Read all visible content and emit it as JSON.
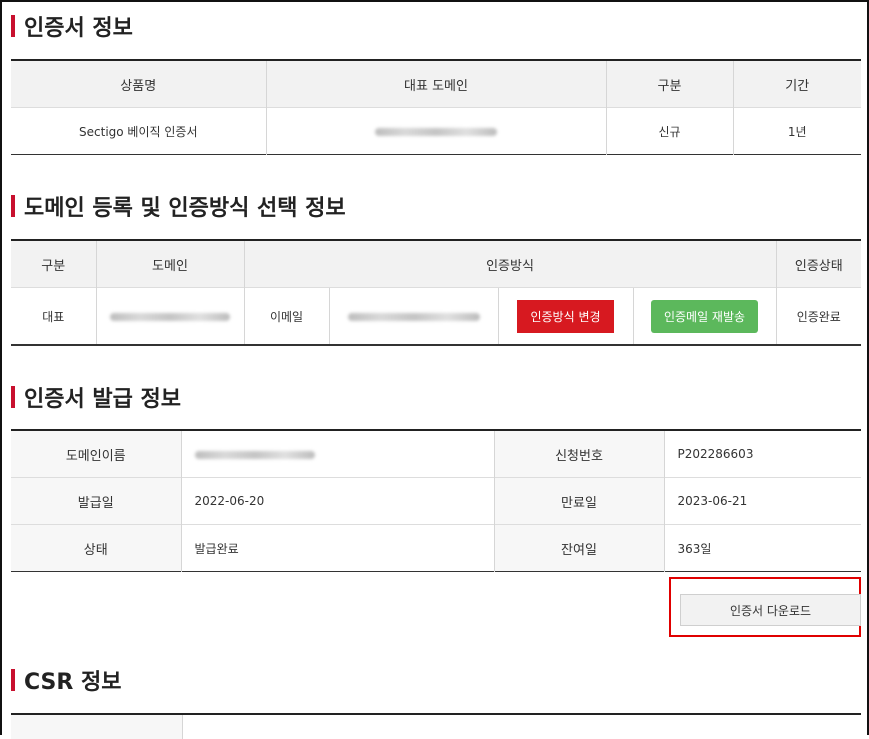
{
  "cert_info": {
    "title": "인증서 정보",
    "headers": [
      "상품명",
      "대표 도메인",
      "구분",
      "기간"
    ],
    "row": {
      "product": "Sectigo 베이직 인증서",
      "type": "신규",
      "period": "1년"
    }
  },
  "domain_info": {
    "title": "도메인 등록 및 인증방식 선택 정보",
    "headers": {
      "type": "구분",
      "domain": "도메인",
      "method": "인증방식",
      "status": "인증상태"
    },
    "row": {
      "type": "대표",
      "method": "이메일",
      "change_button": "인증방식 변경",
      "resend_button": "인증메일 재발송",
      "status": "인증완료"
    }
  },
  "issue_info": {
    "title": "인증서 발급 정보",
    "rows": [
      {
        "label1": "도메인이름",
        "label2": "신청번호",
        "value2": "P202286603"
      },
      {
        "label1": "발급일",
        "value1": "2022-06-20",
        "label2": "만료일",
        "value2": "2023-06-21"
      },
      {
        "label1": "상태",
        "value1": "발급완료",
        "label2": "잔여일",
        "value2": "363일"
      }
    ],
    "download_button": "인증서 다운로드"
  },
  "csr_info": {
    "title": "CSR 정보"
  },
  "colors": {
    "accent": "#c8102e",
    "danger_button": "#d71920",
    "success_button": "#5cb85c",
    "highlight_box": "#e00000"
  }
}
